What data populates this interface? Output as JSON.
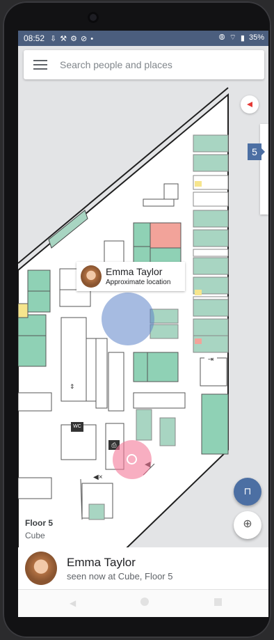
{
  "status_bar": {
    "time": "08:52",
    "left_icons": [
      "download-icon",
      "wrench-icon",
      "settings-icon",
      "blocked-icon",
      "dot-icon"
    ],
    "right_icons": [
      "vibrate-icon",
      "wifi-icon",
      "battery-icon"
    ],
    "battery": "35%"
  },
  "search": {
    "placeholder": "Search people and places",
    "value": ""
  },
  "map": {
    "floor_badge": "5",
    "floor_name": "Floor 5",
    "building": "Cube",
    "icons": [
      "exit-icon",
      "restroom-icon",
      "printer-icon",
      "speaker-icon",
      "mute-icon",
      "stairs-icon",
      "compass-icon"
    ],
    "colors": {
      "green": "#a8d5c2",
      "teal": "#8fd1b5",
      "pink": "#f2a39a",
      "yellow": "#f6e58d",
      "blue": "#5c84c9",
      "pink_marker": "#f37898"
    }
  },
  "callout": {
    "name": "Emma Taylor",
    "subtitle": "Approximate location"
  },
  "labels": {
    "wc": "WC"
  },
  "person_card": {
    "name": "Emma Taylor",
    "status": "seen now at Cube, Floor 5"
  }
}
